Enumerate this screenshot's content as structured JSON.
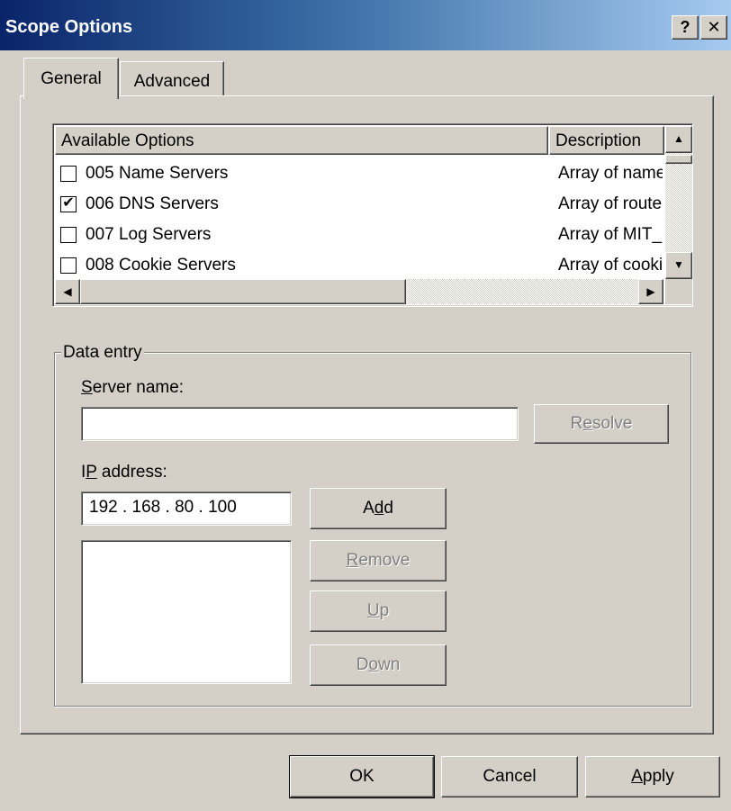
{
  "window": {
    "title": "Scope Options",
    "help_label": "?",
    "close_label": "✕"
  },
  "tabs": [
    {
      "label": "General"
    },
    {
      "label": "Advanced"
    }
  ],
  "options_list": {
    "headers": {
      "name": "Available Options",
      "desc": "Description"
    },
    "rows": [
      {
        "checked": false,
        "name": "005 Name Servers",
        "desc": "Array of name servers"
      },
      {
        "checked": true,
        "name": "006 DNS Servers",
        "desc": "Array of router addresses"
      },
      {
        "checked": false,
        "name": "007 Log Servers",
        "desc": "Array of MIT_LCS UDP log servers"
      },
      {
        "checked": false,
        "name": "008 Cookie Servers",
        "desc": "Array of cookie servers"
      }
    ]
  },
  "data_entry": {
    "legend": "Data entry",
    "server_name": {
      "label_pre": "",
      "label_u": "S",
      "label_post": "erver name:",
      "value": ""
    },
    "resolve": {
      "pre": "R",
      "u": "e",
      "post": "solve"
    },
    "ip": {
      "label_pre": "I",
      "label_u": "P",
      "label_post": " address:",
      "octets": [
        "192",
        "168",
        "80",
        "100"
      ]
    },
    "add": {
      "pre": "A",
      "u": "d",
      "post": "d"
    },
    "remove": {
      "pre": "",
      "u": "R",
      "post": "emove"
    },
    "up": {
      "pre": "",
      "u": "U",
      "post": "p"
    },
    "down": {
      "pre": "D",
      "u": "o",
      "post": "wn"
    }
  },
  "footer": {
    "ok": "OK",
    "cancel": "Cancel",
    "apply": {
      "pre": "",
      "u": "A",
      "post": "pply"
    }
  }
}
